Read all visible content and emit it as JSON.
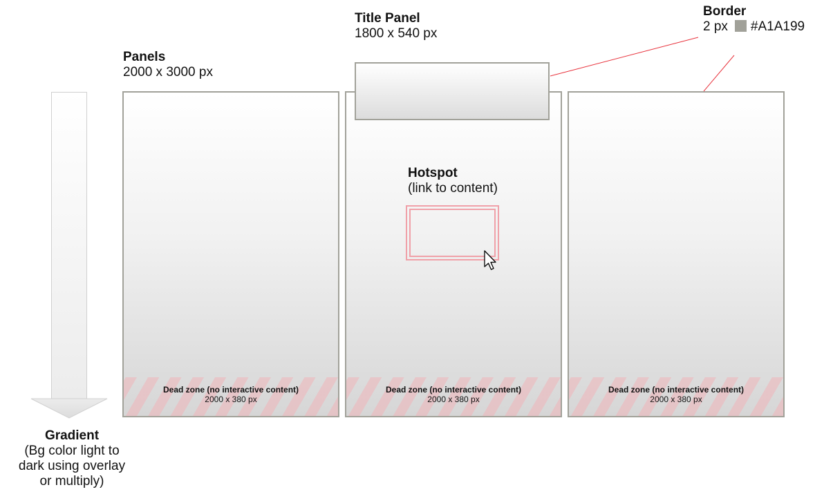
{
  "panels": {
    "title": "Panels",
    "size": "2000 x 3000 px",
    "items": [
      {
        "dead_zone_title": "Dead zone (no interactive content)",
        "dead_zone_size": "2000 x 380 px"
      },
      {
        "dead_zone_title": "Dead zone (no interactive content)",
        "dead_zone_size": "2000 x 380 px"
      },
      {
        "dead_zone_title": "Dead zone (no interactive content)",
        "dead_zone_size": "2000 x 380 px"
      }
    ]
  },
  "title_panel": {
    "title": "Title Panel",
    "size": "1800 x 540 px"
  },
  "border": {
    "title": "Border",
    "width": "2 px",
    "color_label": "#A1A199",
    "color": "#A1A199"
  },
  "hotspot": {
    "title": "Hotspot",
    "description": "(link to content)"
  },
  "gradient": {
    "title": "Gradient",
    "line1": "(Bg color light to",
    "line2": "dark using overlay",
    "line3": "or multiply)"
  },
  "colors": {
    "callout_line": "#e8323c",
    "hotspot": "#f0a0a8",
    "dead_zone_stripe": "#f0b4b9"
  }
}
